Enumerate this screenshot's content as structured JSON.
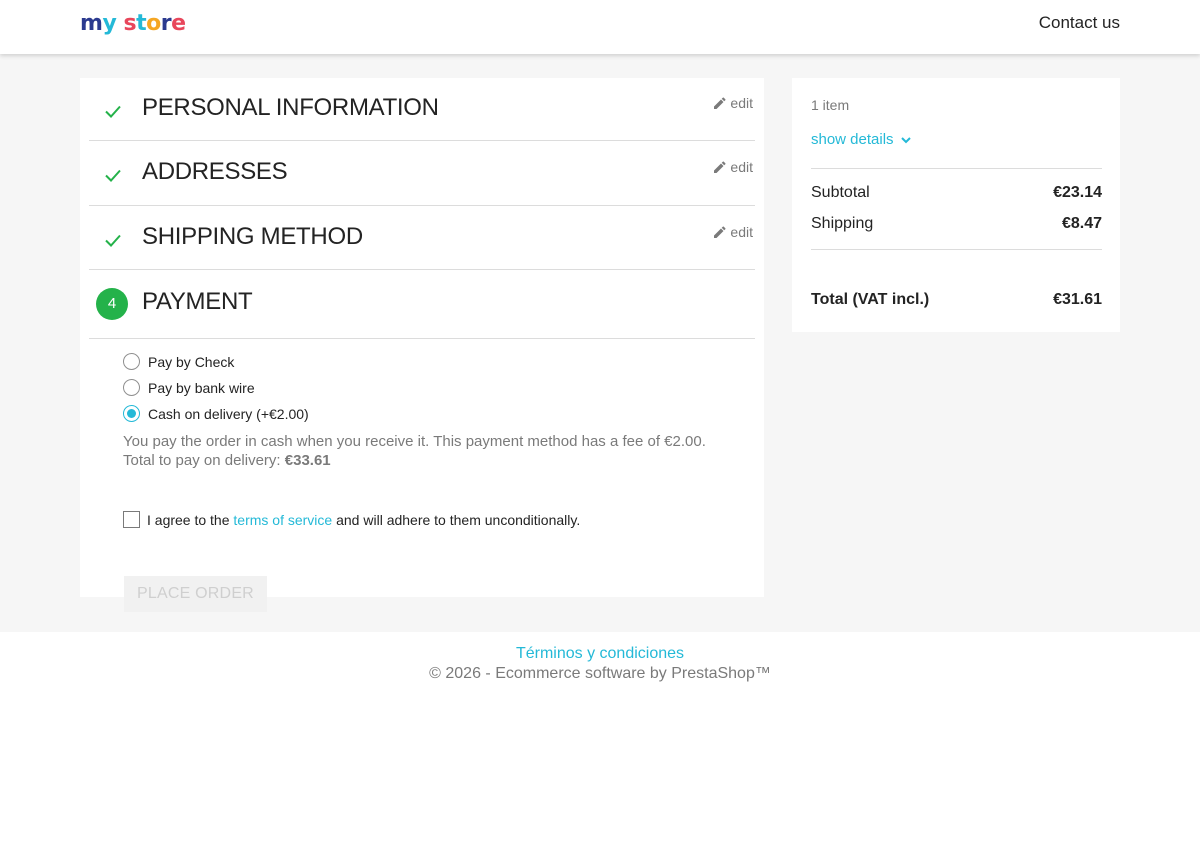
{
  "header": {
    "logo_letters": [
      {
        "ch": "m",
        "color": "#2b3a8f"
      },
      {
        "ch": "y",
        "color": "#24b9d7"
      },
      {
        "ch": " ",
        "color": "#000000"
      },
      {
        "ch": "s",
        "color": "#e8465b"
      },
      {
        "ch": "t",
        "color": "#24b9d7"
      },
      {
        "ch": "o",
        "color": "#f5a623"
      },
      {
        "ch": "r",
        "color": "#2b3a8f"
      },
      {
        "ch": "e",
        "color": "#e8465b"
      }
    ],
    "contact_label": "Contact us"
  },
  "steps": [
    {
      "title": "PERSONAL INFORMATION",
      "status": "complete",
      "edit_label": "edit"
    },
    {
      "title": "ADDRESSES",
      "status": "complete",
      "edit_label": "edit"
    },
    {
      "title": "SHIPPING METHOD",
      "status": "complete",
      "edit_label": "edit"
    },
    {
      "title": "PAYMENT",
      "status": "current",
      "number": "4"
    }
  ],
  "payment": {
    "options": [
      {
        "label": "Pay by Check",
        "selected": false
      },
      {
        "label": "Pay by bank wire",
        "selected": false
      },
      {
        "label": "Cash on delivery (+€2.00)",
        "selected": true
      }
    ],
    "info_line1": "You pay the order in cash when you receive it. This payment method has a fee of €2.00.",
    "info_line2_prefix": "Total to pay on delivery: ",
    "info_line2_amount": "€33.61",
    "terms_prefix": "I agree to the ",
    "terms_link": "terms of service",
    "terms_suffix": " and will adhere to them unconditionally.",
    "terms_checked": false,
    "place_order_label": "PLACE ORDER"
  },
  "summary": {
    "item_count": "1 item",
    "show_details_label": "show details",
    "subtotal_label": "Subtotal",
    "subtotal_value": "€23.14",
    "shipping_label": "Shipping",
    "shipping_value": "€8.47",
    "total_label": "Total (VAT incl.)",
    "total_value": "€31.61"
  },
  "footer": {
    "link_label": "Términos y condiciones",
    "copyright": "© 2026 - Ecommerce software by PrestaShop™"
  },
  "colors": {
    "accent": "#24b9d7",
    "success": "#24b24a",
    "muted": "#7a7a7a"
  }
}
